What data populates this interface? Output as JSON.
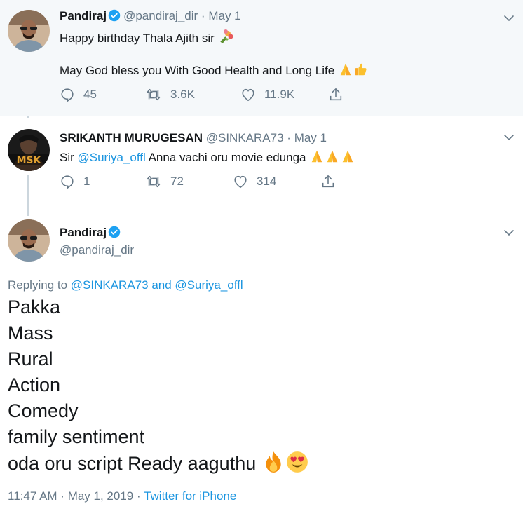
{
  "tweets": [
    {
      "name": "Pandiraj",
      "handle": "@pandiraj_dir",
      "separator": "·",
      "date": "May 1",
      "line1": "Happy birthday Thala Ajith sir",
      "line2": "May God bless you With Good Health and Long Life",
      "replies": "45",
      "retweets": "3.6K",
      "likes": "11.9K"
    },
    {
      "name": "SRIKANTH MURUGESAN",
      "handle": "@SINKARA73",
      "separator": "·",
      "date": "May 1",
      "text_prefix": "Sir ",
      "mention": "@Suriya_offl",
      "text_suffix": " Anna vachi oru movie edunga",
      "avatar_text": "MSK",
      "replies": "1",
      "retweets": "72",
      "likes": "314"
    }
  ],
  "main_tweet": {
    "name": "Pandiraj",
    "handle": "@pandiraj_dir",
    "replying_prefix": "Replying to ",
    "reply_to_1": "@SINKARA73",
    "reply_and": " and ",
    "reply_to_2": "@Suriya_offl",
    "lines": [
      "Pakka",
      "Mass",
      "Rural",
      "Action",
      "Comedy",
      "family sentiment",
      "oda oru script Ready aaguthu"
    ],
    "time": "11:47 AM",
    "footer_separator": " · ",
    "date": "May 1, 2019",
    "source": "Twitter for iPhone"
  },
  "colors": {
    "link": "#1b95e0",
    "muted": "#657786",
    "text": "#14171a",
    "highlight_bg": "#f5f8fa",
    "thread_line": "#ccd6dd"
  },
  "icons": [
    "verified-badge-icon",
    "chevron-down-icon",
    "reply-icon",
    "retweet-icon",
    "like-icon",
    "share-icon",
    "bouquet-emoji",
    "folded-hands-emoji",
    "thumbs-up-emoji",
    "fire-emoji",
    "heart-eyes-emoji"
  ]
}
